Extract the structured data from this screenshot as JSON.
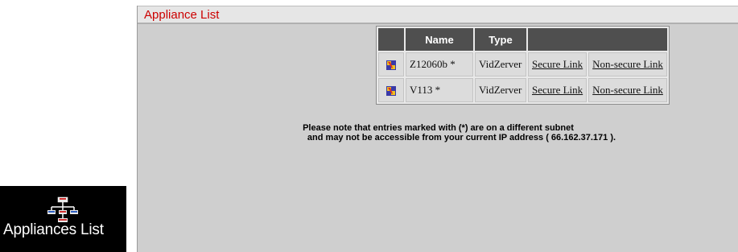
{
  "panel": {
    "title": "Appliance List"
  },
  "table": {
    "headers": [
      "",
      "Name",
      "Type",
      ""
    ],
    "rows": [
      {
        "icon": "vidzerver-icon",
        "name": "Z12060b *",
        "type": "VidZerver",
        "secure_link": "Secure Link",
        "nonsecure_link": "Non-secure Link"
      },
      {
        "icon": "vidzerver-icon",
        "name": "V113 *",
        "type": "VidZerver",
        "secure_link": "Secure Link",
        "nonsecure_link": "Non-secure Link"
      }
    ]
  },
  "note": {
    "line1": "Please note that entries marked with (*) are on a different subnet",
    "line2": "and may not be accessible from your current IP address ( 66.162.37.171 )."
  },
  "desktop_icon": {
    "icon": "network-tree-icon",
    "label": "Appliances List"
  },
  "colors": {
    "title_red": "#cc0000",
    "header_dark": "#4f4f4f",
    "panel_bg": "#cfcfcf"
  }
}
